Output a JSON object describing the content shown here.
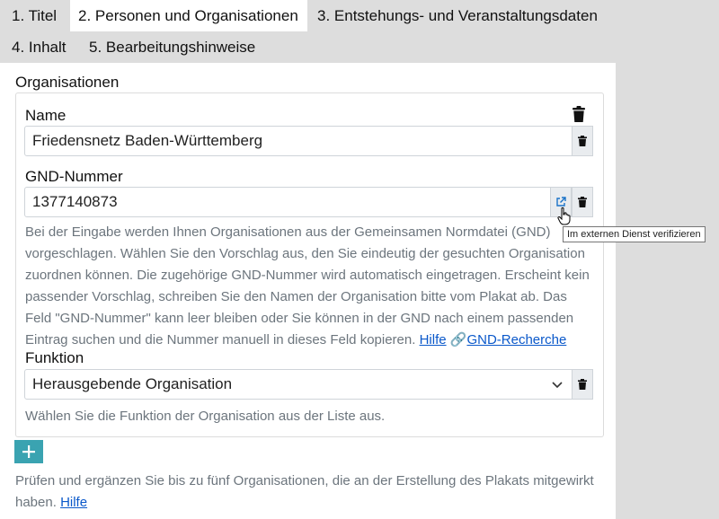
{
  "tabs": [
    {
      "label": "1. Titel"
    },
    {
      "label": "2. Personen und Organisationen",
      "active": true
    },
    {
      "label": "3. Entstehungs- und Veranstaltungsdaten"
    },
    {
      "label": "4. Inhalt"
    },
    {
      "label": "5. Bearbeitungshinweise"
    }
  ],
  "section": {
    "title": "Organisationen"
  },
  "org": {
    "name_label": "Name",
    "name_value": "Friedensnetz Baden-Württemberg",
    "gnd_label": "GND-Nummer",
    "gnd_value": "1377140873",
    "gnd_help": "Bei der Eingabe werden Ihnen Organisationen aus der Gemeinsamen Normdatei (GND) vorgeschlagen. Wählen Sie den Vorschlag aus, den Sie eindeutig der gesuchten Organisation zuordnen können. Die zugehörige GND-Nummer wird automatisch eingetragen. Erscheint kein passender Vorschlag, schreiben Sie den Namen der Organisation bitte vom Plakat ab. Das Feld \"GND-Nummer\" kann leer bleiben oder Sie können in der GND nach einem passenden Eintrag suchen und die Nummer manuell in dieses Feld kopieren.",
    "help_link": "Hilfe",
    "gnd_research_link": "GND-Recherche",
    "function_label": "Funktion",
    "function_value": "Herausgebende Organisation",
    "function_help": "Wählen Sie die Funktion der Organisation aus der Liste aus."
  },
  "tooltip": "Im externen Dienst verifizieren",
  "footer": {
    "help_text": "Prüfen und ergänzen Sie bis zu fünf Organisationen, die an der Erstellung des Plakats mitgewirkt haben.",
    "help_link": "Hilfe"
  },
  "colors": {
    "tab_bar": "#dddddd",
    "add_button": "#3aa3b1",
    "link": "#0a58ca"
  },
  "icons": [
    "trash-icon",
    "external-link-icon",
    "chevron-down-icon",
    "link-icon",
    "plus-icon",
    "pointer-cursor-icon"
  ]
}
